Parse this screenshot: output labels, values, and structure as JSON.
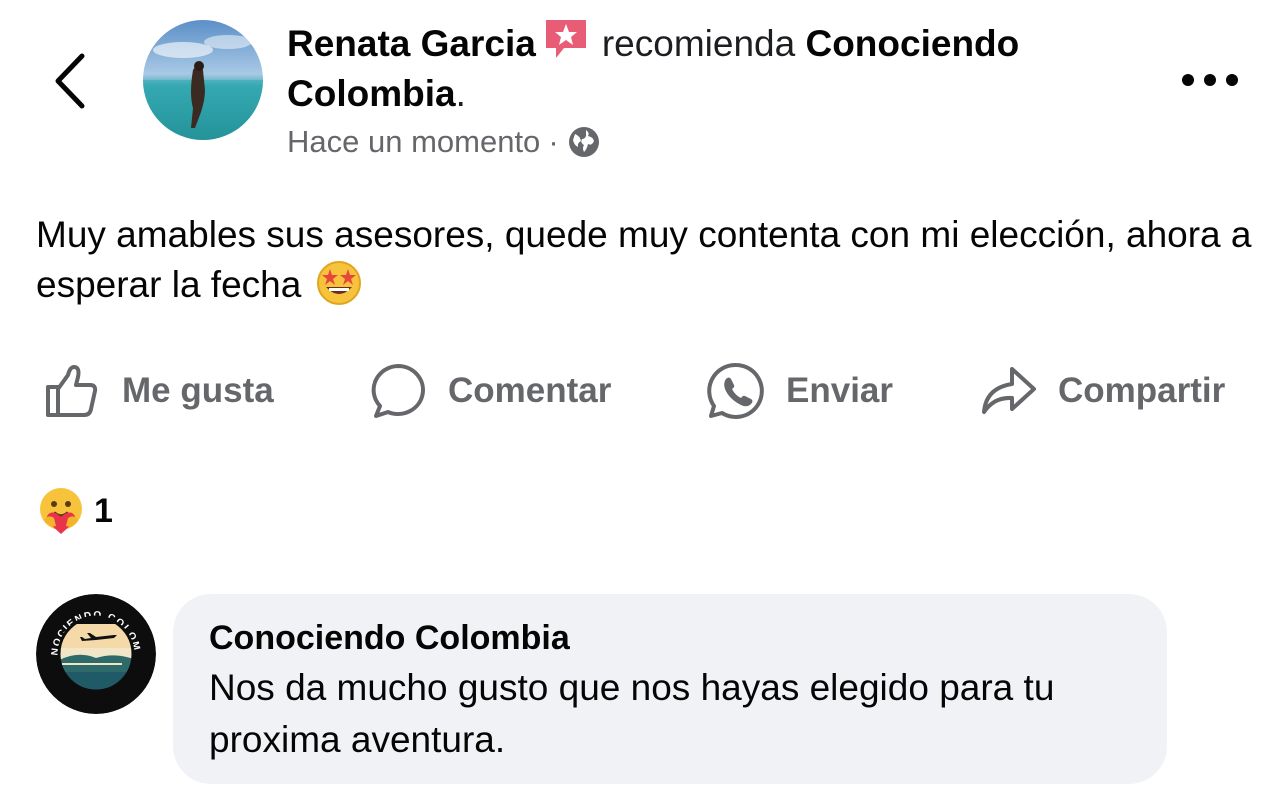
{
  "header": {
    "author": "Renata Garcia",
    "recommends_text": "recomienda",
    "page_name": "Conociendo Colombia",
    "period": ".",
    "timestamp": "Hace un momento",
    "separator": "·"
  },
  "post": {
    "text": "Muy amables sus asesores, quede muy contenta con mi elección, ahora a esperar la fecha"
  },
  "actions": {
    "like": "Me gusta",
    "comment": "Comentar",
    "send": "Enviar",
    "share": "Compartir"
  },
  "reactions": {
    "count": "1"
  },
  "comment": {
    "author": "Conociendo Colombia",
    "text": "Nos da mucho gusto que nos hayas elegido para tu proxima aventura.",
    "logo_text": "CONOCIENDO COLOMBIA"
  },
  "colors": {
    "secondary_text": "#65676b",
    "bubble_bg": "#f0f2f5",
    "badge": "#e85d75"
  },
  "icons": [
    "back-icon",
    "more-icon",
    "recommend-star-icon",
    "globe-icon",
    "like-icon",
    "comment-icon",
    "whatsapp-icon",
    "share-icon",
    "star-struck-emoji",
    "care-emoji"
  ]
}
